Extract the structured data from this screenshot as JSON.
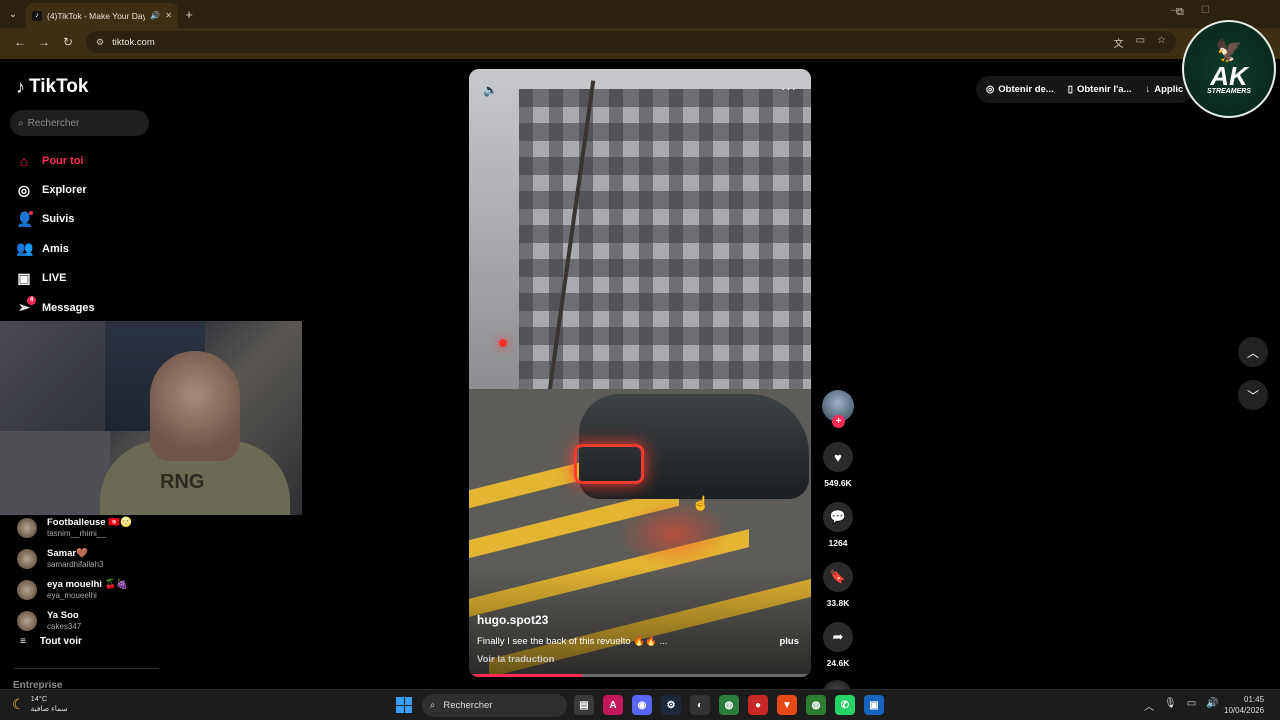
{
  "browser": {
    "tab_title": "(4)TikTok - Make Your Day",
    "url": "tiktok.com"
  },
  "sidebar": {
    "logo": "TikTok",
    "search_placeholder": "Rechercher",
    "nav": [
      {
        "label": "Pour toi",
        "icon": "home-icon",
        "active": true
      },
      {
        "label": "Explorer",
        "icon": "compass-icon"
      },
      {
        "label": "Suivis",
        "icon": "following-icon"
      },
      {
        "label": "Amis",
        "icon": "friends-icon"
      },
      {
        "label": "LIVE",
        "icon": "live-icon"
      },
      {
        "label": "Messages",
        "icon": "messages-icon",
        "badge": "4"
      }
    ],
    "following": [
      {
        "name": "Footballeuse 🇹🇳🌝",
        "username": "tasnim__rhimi__"
      },
      {
        "name": "Samar🤎",
        "username": "samardhifallah3"
      },
      {
        "name": "eya mouelhi 🍒🍇",
        "username": "eya_moueelhi"
      },
      {
        "name": "Ya Soo",
        "username": "cakes347"
      }
    ],
    "see_all": "Tout voir",
    "entreprise": "Entreprise"
  },
  "webcam": {
    "hoodie_text": "RNG"
  },
  "video": {
    "username": "hugo.spot23",
    "caption": "Finally I see the back of this revuelto 🔥🔥 ...",
    "more": "plus",
    "translate": "Voir la traduction",
    "progress": 0.33
  },
  "actions": {
    "likes": "549.6K",
    "comments": "1264",
    "saves": "33.8K",
    "shares": "24.6K"
  },
  "top_buttons": [
    "Obtenir de...",
    "Obtenir l'a...",
    "Applic"
  ],
  "overlay_logo": {
    "text": "AK",
    "sub": "STREAMERS"
  },
  "taskbar": {
    "temp": "14°C",
    "weather_desc": "سماء صافية",
    "search_label": "Rechercher",
    "time": "01:45",
    "date": "10/04/2026"
  },
  "colors": {
    "accent": "#fe2c55",
    "chrome": "#3c2f12"
  }
}
